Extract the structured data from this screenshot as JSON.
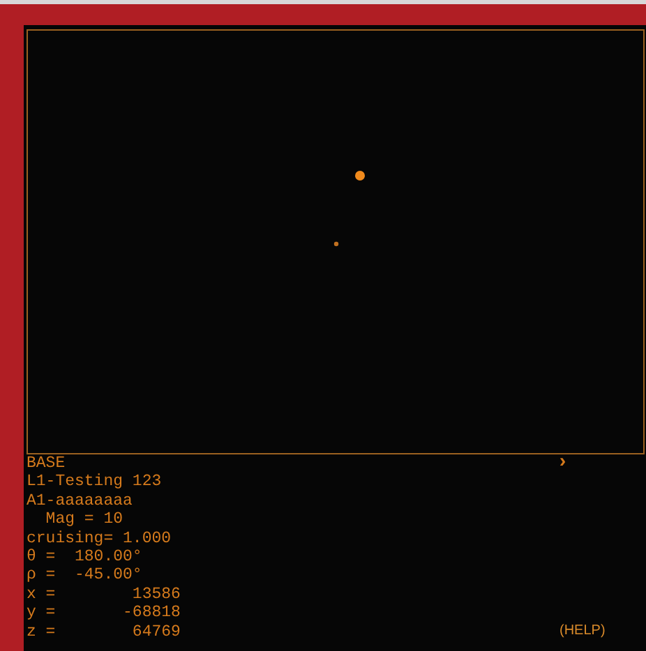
{
  "status_lines": [
    "BASE",
    "L1-Testing 123",
    "A1-aaaaaaaa",
    "  Mag = 10",
    "cruising= 1.000",
    "θ =  180.00°",
    "ρ =  -45.00°",
    "x =        13586",
    "y =       -68818",
    "z =        64769"
  ],
  "next_button": "›",
  "help_button": "(HELP)"
}
